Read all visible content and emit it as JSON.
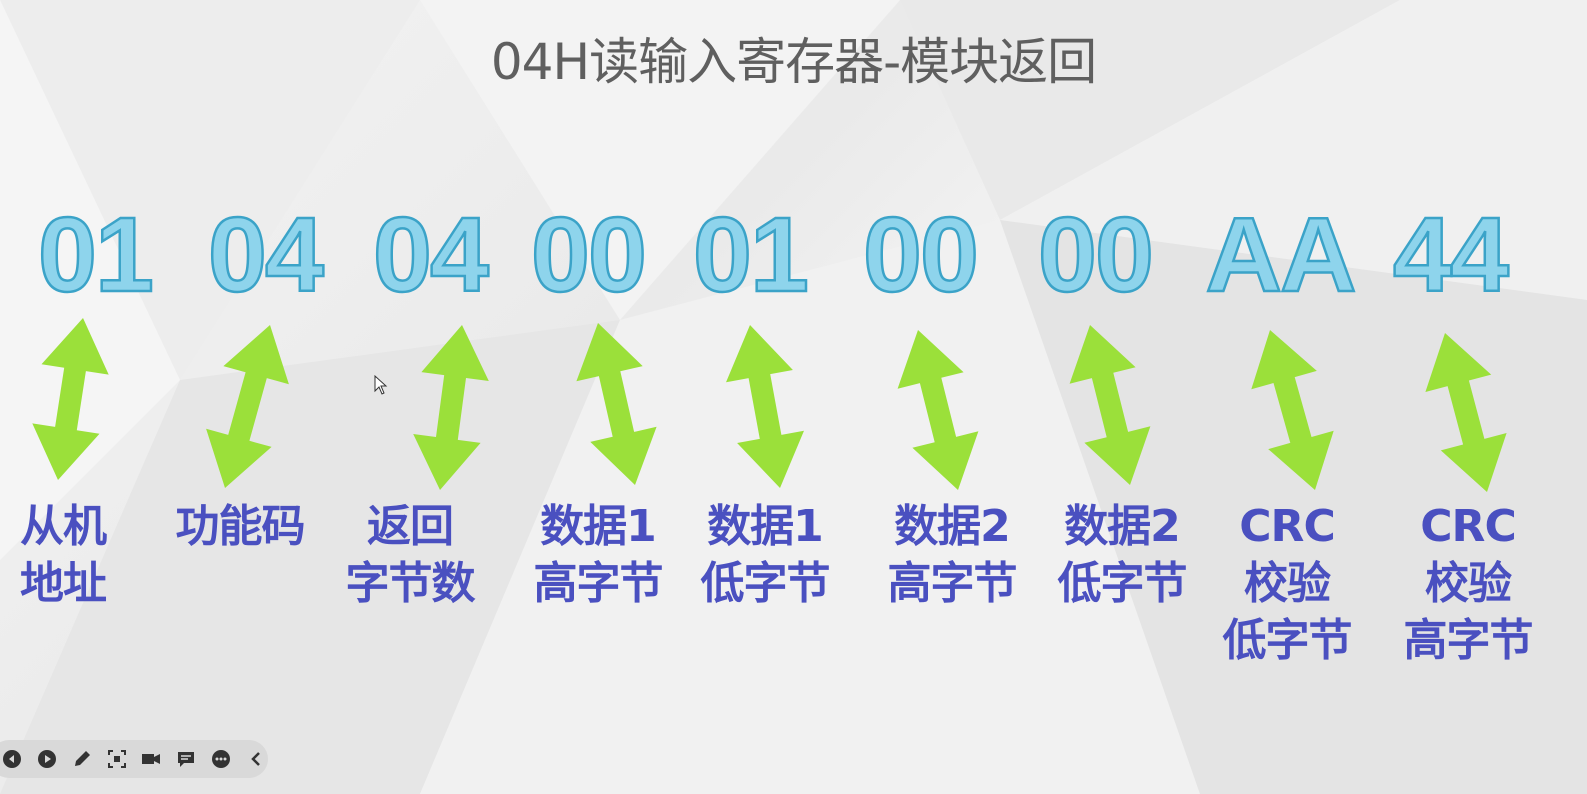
{
  "slide": {
    "title": "04H读输入寄存器-模块返回"
  },
  "bytes": [
    {
      "value": "01",
      "label": "从机\n地址"
    },
    {
      "value": "04",
      "label": "功能码"
    },
    {
      "value": "04",
      "label": "返回\n字节数"
    },
    {
      "value": "00",
      "label": "数据1\n高字节"
    },
    {
      "value": "01",
      "label": "数据1\n低字节"
    },
    {
      "value": "00",
      "label": "数据2\n高字节"
    },
    {
      "value": "00",
      "label": "数据2\n低字节"
    },
    {
      "value": "AA",
      "label": "CRC\n校验\n低字节"
    },
    {
      "value": "44",
      "label": "CRC\n校验\n高字节"
    }
  ],
  "colors": {
    "byte_fill": "#8ed4ec",
    "byte_stroke": "#3ba3c8",
    "arrow": "#9be03a",
    "label": "#4a50c0",
    "title": "#5f5f5f"
  },
  "toolbar": {
    "icons": [
      "previous-icon",
      "play-icon",
      "pen-icon",
      "screenshot-icon",
      "camera-icon",
      "comment-icon",
      "more-icon",
      "collapse-icon"
    ]
  }
}
